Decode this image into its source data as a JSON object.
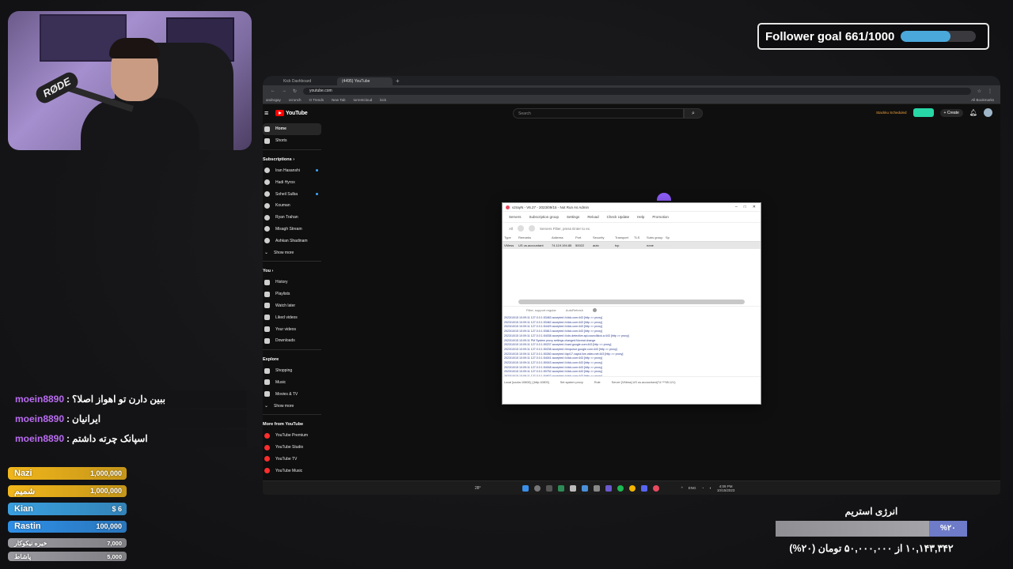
{
  "overlay": {
    "follower_goal": {
      "label": "Follower goal 661/1000",
      "current": 661,
      "target": 1000
    },
    "chat": [
      {
        "user": "moein8890",
        "text": "ببین دارن تو اهواز اصلا؟"
      },
      {
        "user": "moein8890",
        "text": "ایرانیان"
      },
      {
        "user": "moein8890",
        "text": "اسپانک چرته داشتم"
      }
    ],
    "leaderboard": [
      {
        "name": "Nazi",
        "amount": "1,000,000",
        "color": "#f1b61b"
      },
      {
        "name": "شمیم",
        "amount": "1,000,000",
        "color": "#f1b61b"
      },
      {
        "name": "Kian",
        "amount": "$ 6",
        "color": "#3aa0e0"
      },
      {
        "name": "Rastin",
        "amount": "100,000",
        "color": "#2f8fe6"
      },
      {
        "name": "خیره نیکوکار",
        "amount": "7,000",
        "color": "#9a9aa0"
      },
      {
        "name": "پاشاط",
        "amount": "5,000",
        "color": "#9a9aa0"
      }
    ],
    "energy": {
      "title": "انرژی استریم",
      "percent_label": "%۲۰",
      "percent": 20,
      "summary": "۱۰,۱۴۳,۳۴۲ از ۵۰,۰۰۰,۰۰۰ تومان (۲۰%)"
    }
  },
  "browser": {
    "tabs": [
      "Kick Dashboard",
      "(4495) YouTube"
    ],
    "new_tab": "+",
    "address": "youtube.com",
    "bookmarks": [
      "androgay",
      "vcrunch",
      "O Trends",
      "New Tab",
      "torrentcloud",
      "kick",
      "All Bookmarks"
    ]
  },
  "youtube": {
    "logo_text": "YouTube",
    "search_placeholder": "Search",
    "create_label": "Create",
    "premium_chip": "Stackku Scheduled",
    "nav": [
      {
        "label": "Home",
        "icon": "home-icon"
      },
      {
        "label": "Shorts",
        "icon": "shorts-icon"
      }
    ],
    "subscriptions_heading": "Subscriptions",
    "subscriptions": [
      {
        "label": "Iran Hasanshi",
        "live": true
      },
      {
        "label": "Hadi Hyrox",
        "live": false
      },
      {
        "label": "Soheil Sulba",
        "live": true
      },
      {
        "label": "Kouman",
        "live": false
      },
      {
        "label": "Ryan Trahan",
        "live": false
      },
      {
        "label": "Misagh Stream",
        "live": false
      },
      {
        "label": "Ashkan Shadinam",
        "live": false
      }
    ],
    "show_more": "Show more",
    "you_heading": "You",
    "you_items": [
      "History",
      "Playlists",
      "Watch later",
      "Liked videos",
      "Your videos",
      "Downloads"
    ],
    "explore_heading": "Explore",
    "explore_items": [
      "Shopping",
      "Music",
      "Movies & TV"
    ],
    "explore_show_more": "Show more",
    "more_heading": "More from YouTube",
    "more_items": [
      "YouTube Premium",
      "YouTube Studio",
      "YouTube TV",
      "YouTube Music"
    ]
  },
  "v2ray": {
    "title": "v2rayN - V6.27 - 2023/09/15 - Not Run As Admin",
    "menu": [
      "Servers",
      "Subscription group",
      "Settings",
      "Reload",
      "Check Update",
      "Help",
      "Promotion"
    ],
    "filter_label": "All",
    "filter_placeholder": "Servers Filter, press Enter to ex",
    "columns": [
      "Type",
      "Remarks",
      "Address",
      "Port",
      "Security",
      "Transport",
      "TLS",
      "Subs group",
      "Sp"
    ],
    "row": [
      "VMess",
      "US us.accountant",
      "74.119.194.85",
      "50022",
      "auto",
      "tcp",
      "",
      "none",
      ""
    ],
    "options": [
      "Filter, support regular",
      "AutoRefresh"
    ],
    "log": [
      "2023/10/15 10:09:11 127.0.0.1:53463 accepted //click.com:443 [http >> proxy]",
      "2023/10/15 10:09:11 127.0.0.1:53462 accepted //click.com:443 [http >> proxy]",
      "2023/10/15 10:09:11 127.0.0.1:54429 accepted //click.com:443 [http >> proxy]",
      "2023/10/15 10:09:11 127.0.0.1:53813 accepted //click.com:443 [http >> proxy]",
      "2023/10/15 10:09:11 127.0.0.1:54038 accepted //cdn-detective.api.councilkick.a:443 [http >> proxy]",
      "2023/10/15 10:09:11 PM System proxy settings changed:Normal change",
      "2023/10/15 10:09:11 127.0.0.1:50237 accepted //cast.google.com:443 [http >> proxy]",
      "2023/10/15 10:09:11 127.0.0.1:50238 accepted //enqueue.google.com:443 [http >> proxy]",
      "2023/10/15 10:09:11 127.0.0.1:50260 accepted //api17.vayiol.live-video.net:443 [http >> proxy]",
      "2023/10/15 10:09:11 127.0.0.1:54041 accepted //click.com:443 [http >> proxy]",
      "2023/10/15 10:09:11 127.0.0.1:50043 accepted //click.com:443 [http >> proxy]",
      "2023/10/15 10:09:11 127.0.0.1:54048 accepted //click.com:443 [http >> proxy]",
      "2023/10/15 10:09:11 127.0.0.1:50752 accepted //click.com:443 [http >> proxy]",
      "2023/10/15 10:09:11 127.0.0.1:54632 accepted //click.com:443 [http >> proxy]"
    ],
    "status": [
      "Local [socks:10808] | [http:10809]",
      "Set system proxy",
      "Rule",
      "Server [VMess] US us.accountant(74.***55.121)"
    ],
    "status2": "LAN:None"
  },
  "taskbar": {
    "weather": "28°",
    "tray": "ENG",
    "clock": "4:09 PM",
    "date": "10/15/2023"
  }
}
